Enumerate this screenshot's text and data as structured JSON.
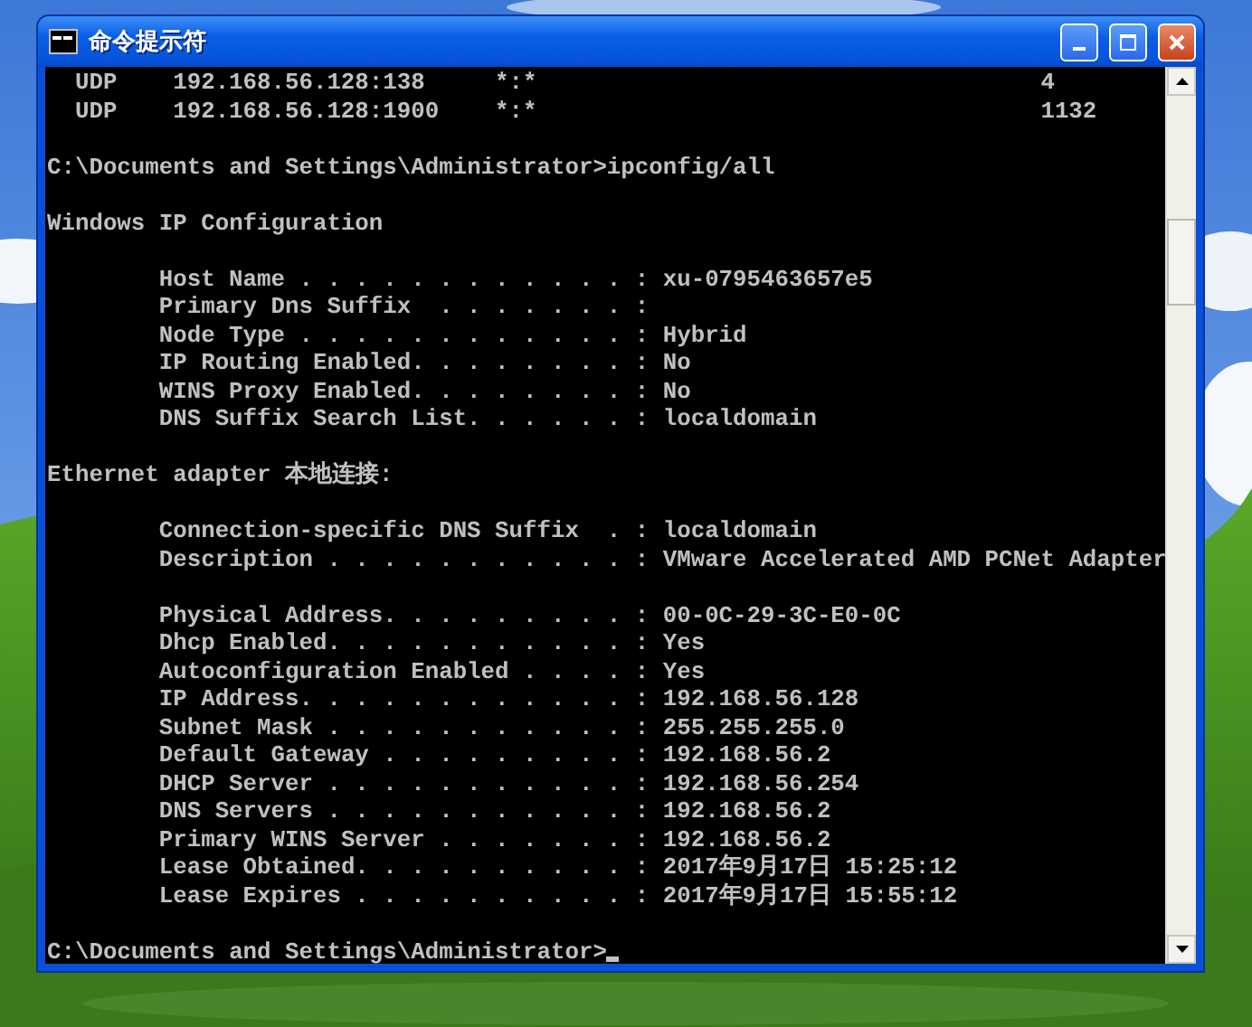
{
  "window": {
    "title": "命令提示符"
  },
  "console": {
    "lines": [
      {
        "kind": "netstat",
        "proto": "UDP",
        "local": "192.168.56.128:138",
        "foreign": "*:*",
        "pid": "4"
      },
      {
        "kind": "netstat",
        "proto": "UDP",
        "local": "192.168.56.128:1900",
        "foreign": "*:*",
        "pid": "1132"
      },
      {
        "kind": "blank"
      },
      {
        "kind": "prompt",
        "text": "C:\\Documents and Settings\\Administrator>ipconfig/all",
        "cursor": false
      },
      {
        "kind": "blank"
      },
      {
        "kind": "text",
        "text": "Windows IP Configuration"
      },
      {
        "kind": "blank"
      },
      {
        "kind": "field",
        "label": "Host Name . . . . . . . . . . . . :",
        "value": "xu-0795463657e5"
      },
      {
        "kind": "field",
        "label": "Primary Dns Suffix  . . . . . . . :"
      },
      {
        "kind": "field",
        "label": "Node Type . . . . . . . . . . . . :",
        "value": "Hybrid"
      },
      {
        "kind": "field",
        "label": "IP Routing Enabled. . . . . . . . :",
        "value": "No"
      },
      {
        "kind": "field",
        "label": "WINS Proxy Enabled. . . . . . . . :",
        "value": "No"
      },
      {
        "kind": "field",
        "label": "DNS Suffix Search List. . . . . . :",
        "value": "localdomain"
      },
      {
        "kind": "blank"
      },
      {
        "kind": "text",
        "text": "Ethernet adapter 本地连接:"
      },
      {
        "kind": "blank"
      },
      {
        "kind": "field",
        "label": "Connection-specific DNS Suffix  . :",
        "value": "localdomain"
      },
      {
        "kind": "field",
        "label": "Description . . . . . . . . . . . :",
        "value": "VMware Accelerated AMD PCNet Adapter"
      },
      {
        "kind": "blank"
      },
      {
        "kind": "field",
        "label": "Physical Address. . . . . . . . . :",
        "value": "00-0C-29-3C-E0-0C"
      },
      {
        "kind": "field",
        "label": "Dhcp Enabled. . . . . . . . . . . :",
        "value": "Yes"
      },
      {
        "kind": "field",
        "label": "Autoconfiguration Enabled . . . . :",
        "value": "Yes"
      },
      {
        "kind": "field",
        "label": "IP Address. . . . . . . . . . . . :",
        "value": "192.168.56.128"
      },
      {
        "kind": "field",
        "label": "Subnet Mask . . . . . . . . . . . :",
        "value": "255.255.255.0"
      },
      {
        "kind": "field",
        "label": "Default Gateway . . . . . . . . . :",
        "value": "192.168.56.2"
      },
      {
        "kind": "field",
        "label": "DHCP Server . . . . . . . . . . . :",
        "value": "192.168.56.254"
      },
      {
        "kind": "field",
        "label": "DNS Servers . . . . . . . . . . . :",
        "value": "192.168.56.2"
      },
      {
        "kind": "field",
        "label": "Primary WINS Server . . . . . . . :",
        "value": "192.168.56.2"
      },
      {
        "kind": "field",
        "label": "Lease Obtained. . . . . . . . . . :",
        "value": "2017年9月17日 15:25:12"
      },
      {
        "kind": "field",
        "label": "Lease Expires . . . . . . . . . . :",
        "value": "2017年9月17日 15:55:12"
      },
      {
        "kind": "blank"
      },
      {
        "kind": "prompt",
        "text": "C:\\Documents and Settings\\Administrator>",
        "cursor": true
      }
    ]
  }
}
